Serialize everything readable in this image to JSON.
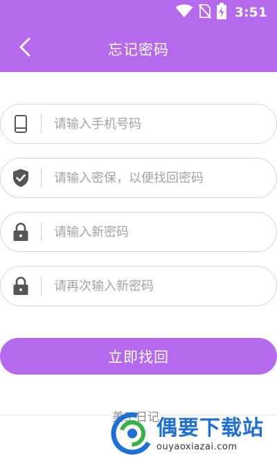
{
  "status_bar": {
    "time": "3:51",
    "icons": [
      "wifi-icon",
      "no-sim-icon",
      "battery-charging-icon"
    ]
  },
  "header": {
    "title": "忘记密码",
    "back_icon": "chevron-left-icon"
  },
  "form": {
    "phone": {
      "placeholder": "请输入手机号码",
      "value": "",
      "icon": "phone-icon"
    },
    "security": {
      "placeholder": "请输入密保，以便找回密码",
      "value": "",
      "icon": "shield-check-icon"
    },
    "new_password": {
      "placeholder": "请输入新密码",
      "value": "",
      "icon": "lock-icon"
    },
    "confirm_password": {
      "placeholder": "请再次输入新密码",
      "value": "",
      "icon": "lock-icon"
    },
    "submit_label": "立即找回"
  },
  "footer": {
    "app_name": "美工日记"
  },
  "watermark": {
    "title": "偶要下载站",
    "url": "ouyaoxiazai.com"
  },
  "colors": {
    "accent": "#b569ec",
    "placeholder": "#a3a3a3",
    "icon": "#555555",
    "watermark_blue": "#1e6fd6"
  }
}
